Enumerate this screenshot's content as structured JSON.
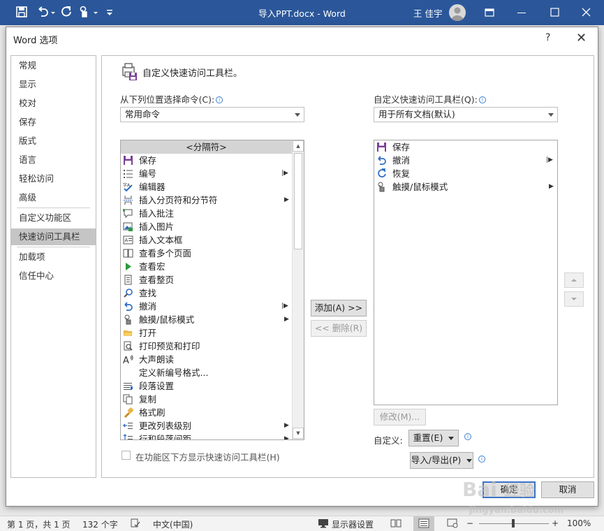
{
  "window": {
    "title": "导入PPT.docx  -  Word",
    "user": "王 佳宇",
    "qat_icons": [
      "save-icon",
      "undo-icon",
      "redo-icon",
      "touch-mode-icon",
      "customize-dropdown-icon"
    ]
  },
  "dialog": {
    "title": "Word 选项",
    "help": "?",
    "close": "✕",
    "nav": [
      {
        "label": "常规",
        "active": false
      },
      {
        "label": "显示",
        "active": false
      },
      {
        "label": "校对",
        "active": false
      },
      {
        "label": "保存",
        "active": false
      },
      {
        "label": "版式",
        "active": false
      },
      {
        "label": "语言",
        "active": false
      },
      {
        "label": "轻松访问",
        "active": false
      },
      {
        "label": "高级",
        "active": false
      },
      {
        "label": "自定义功能区",
        "active": false
      },
      {
        "label": "快速访问工具栏",
        "active": true
      },
      {
        "label": "加载项",
        "active": false
      },
      {
        "label": "信任中心",
        "active": false
      }
    ],
    "heading": "自定义快速访问工具栏。",
    "choose_label": "从下列位置选择命令(C):",
    "choose_value": "常用命令",
    "customize_label": "自定义快速访问工具栏(Q):",
    "customize_value": "用于所有文档(默认)",
    "commands": [
      {
        "label": "<分隔符>",
        "icon": "",
        "submenu": false,
        "selected": true
      },
      {
        "label": "保存",
        "icon": "save-icon",
        "submenu": false
      },
      {
        "label": "编号",
        "icon": "numbering-icon",
        "submenu": true
      },
      {
        "label": "编辑器",
        "icon": "editor-icon",
        "submenu": false
      },
      {
        "label": "插入分页符和分节符",
        "icon": "page-break-icon",
        "submenu": true
      },
      {
        "label": "插入批注",
        "icon": "comment-icon",
        "submenu": false
      },
      {
        "label": "插入图片",
        "icon": "picture-icon",
        "submenu": false
      },
      {
        "label": "插入文本框",
        "icon": "textbox-icon",
        "submenu": false
      },
      {
        "label": "查看多个页面",
        "icon": "multi-page-icon",
        "submenu": false
      },
      {
        "label": "查看宏",
        "icon": "macro-icon",
        "submenu": false
      },
      {
        "label": "查看整页",
        "icon": "one-page-icon",
        "submenu": false
      },
      {
        "label": "查找",
        "icon": "find-icon",
        "submenu": false
      },
      {
        "label": "撤消",
        "icon": "undo-icon",
        "submenu": true
      },
      {
        "label": "触摸/鼠标模式",
        "icon": "touch-mode-icon",
        "submenu": true
      },
      {
        "label": "打开",
        "icon": "open-folder-icon",
        "submenu": false
      },
      {
        "label": "打印预览和打印",
        "icon": "print-preview-icon",
        "submenu": false
      },
      {
        "label": "大声朗读",
        "icon": "read-aloud-icon",
        "submenu": false
      },
      {
        "label": "定义新编号格式...",
        "icon": "",
        "submenu": false
      },
      {
        "label": "段落设置",
        "icon": "paragraph-icon",
        "submenu": false
      },
      {
        "label": "复制",
        "icon": "copy-icon",
        "submenu": false
      },
      {
        "label": "格式刷",
        "icon": "format-painter-icon",
        "submenu": false
      },
      {
        "label": "更改列表级别",
        "icon": "list-level-icon",
        "submenu": true
      },
      {
        "label": "行和段落间距",
        "icon": "line-spacing-icon",
        "submenu": true
      }
    ],
    "qat_items": [
      {
        "label": "保存",
        "icon": "save-icon",
        "submenu": false
      },
      {
        "label": "撤消",
        "icon": "undo-icon",
        "submenu": true
      },
      {
        "label": "恢复",
        "icon": "redo-icon",
        "submenu": false
      },
      {
        "label": "触摸/鼠标模式",
        "icon": "touch-mode-icon",
        "submenu": true
      }
    ],
    "add_button": "添加(A) >>",
    "remove_button": "<< 删除(R)",
    "modify_button": "修改(M)...",
    "customize_row_label": "自定义:",
    "reset_button": "重置(E)",
    "import_export_button": "导入/导出(P)",
    "show_below_ribbon": "在功能区下方显示快速访问工具栏(H)",
    "ok_button": "确定",
    "cancel_button": "取消"
  },
  "statusbar": {
    "page": "第 1 页，共 1 页",
    "words": "132 个字",
    "language": "中文(中国)",
    "display_settings": "显示器设置",
    "zoom": "100%",
    "zoom_minus": "−",
    "zoom_plus": "+"
  },
  "watermark": "Bai 经验 jingyan.baidu.com"
}
